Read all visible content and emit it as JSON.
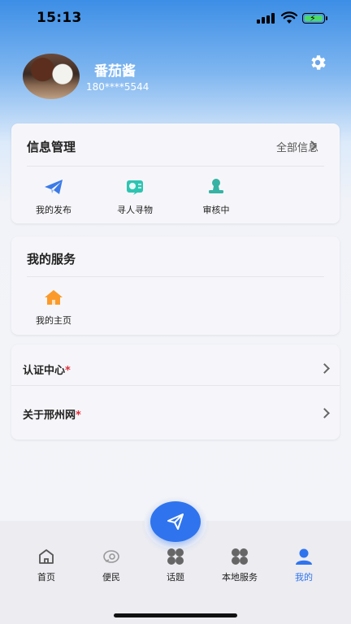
{
  "status_bar": {
    "time": "15:13"
  },
  "profile": {
    "name": "番茄酱",
    "phone": "180****5544"
  },
  "info_management": {
    "title": "信息管理",
    "all_label": "全部信息",
    "items": [
      {
        "label": "我的发布",
        "icon": "paper-plane-icon"
      },
      {
        "label": "寻人寻物",
        "icon": "search-people-icon"
      },
      {
        "label": "审核中",
        "icon": "review-stamp-icon"
      }
    ]
  },
  "my_services": {
    "title": "我的服务",
    "items": [
      {
        "label": "我的主页",
        "icon": "home-icon"
      }
    ]
  },
  "menu_list": {
    "items": [
      {
        "label": "认证中心",
        "marker": "*"
      },
      {
        "label": "关于邢州网",
        "marker": "*"
      }
    ]
  },
  "tabbar": {
    "active": "我的",
    "tabs": [
      {
        "label": "首页",
        "icon": "home-outline-icon"
      },
      {
        "label": "便民",
        "icon": "convenience-icon"
      },
      {
        "label": "话题",
        "icon": "clover-icon"
      },
      {
        "label": "本地服务",
        "icon": "clover-icon"
      },
      {
        "label": "我的",
        "icon": "user-icon"
      }
    ]
  },
  "colors": {
    "accent": "#2f74ee",
    "required_marker": "#e0303a"
  }
}
